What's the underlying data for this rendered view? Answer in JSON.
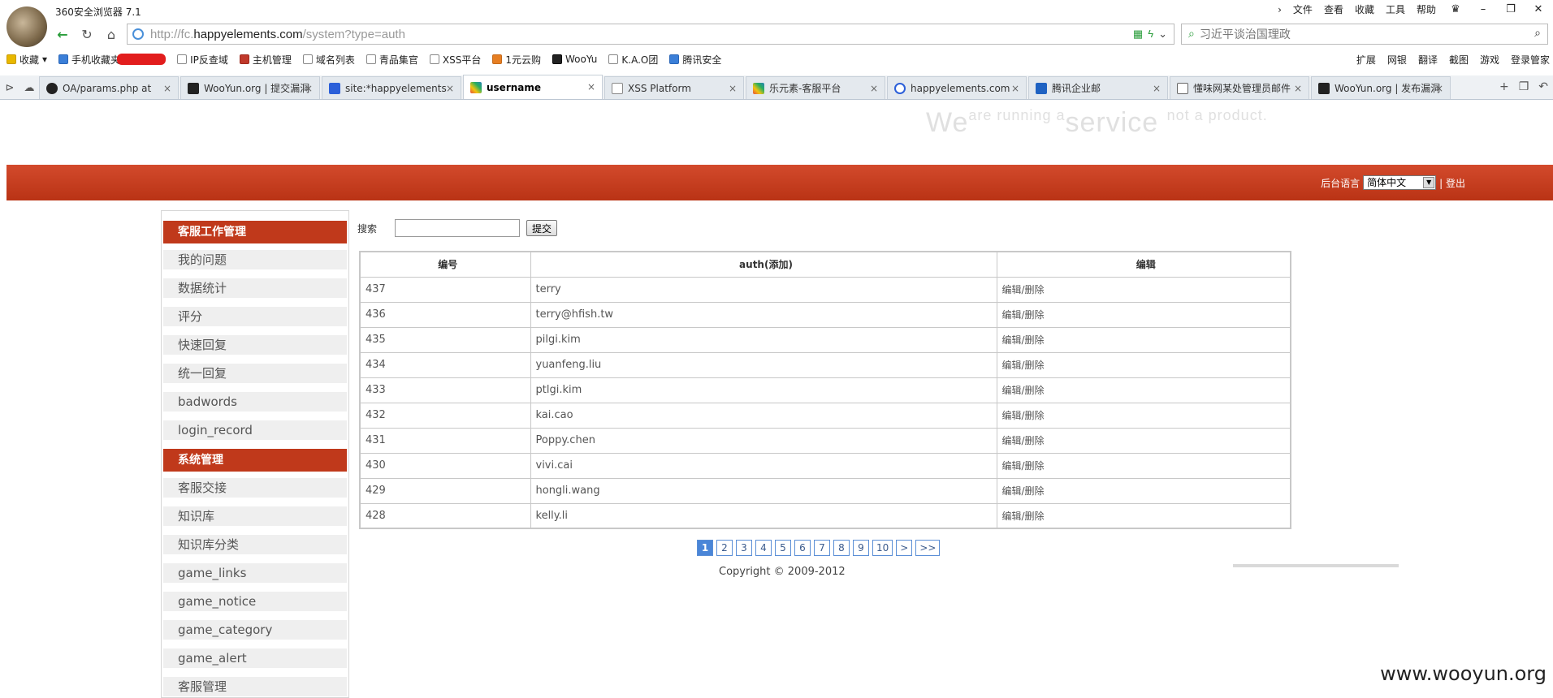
{
  "browser": {
    "title": "360安全浏览器 7.1",
    "menu": [
      "文件",
      "查看",
      "收藏",
      "工具",
      "帮助"
    ],
    "url_prefix": "http://fc.",
    "url_domain": "happyelements.com",
    "url_path": "/system?type=auth",
    "search_placeholder": "习近平谈治国理政",
    "bookmarks": [
      "收藏",
      "手机收藏夹",
      "IP反查域",
      "主机管理",
      "域名列表",
      "青品集官",
      "XSS平台",
      "1元云购",
      "WooYu",
      "K.A.O团",
      "腾讯安全"
    ],
    "bookmarks_right": [
      "扩展",
      "网银",
      "翻译",
      "截图",
      "游戏",
      "登录管家"
    ],
    "tabs": [
      {
        "label": "OA/params.php at",
        "active": false
      },
      {
        "label": "WooYun.org | 提交漏洞",
        "active": false
      },
      {
        "label": "site:*happyelements",
        "active": false
      },
      {
        "label": "username",
        "active": true
      },
      {
        "label": "XSS Platform",
        "active": false
      },
      {
        "label": "乐元素-客服平台",
        "active": false
      },
      {
        "label": "happyelements.com",
        "active": false
      },
      {
        "label": "腾讯企业邮",
        "active": false
      },
      {
        "label": "懂味网某处管理员邮件",
        "active": false
      },
      {
        "label": "WooYun.org | 发布漏洞",
        "active": false
      }
    ]
  },
  "header": {
    "slogan_a": "We",
    "slogan_b": "are running a",
    "slogan_c": "service",
    "slogan_d": "not a product.",
    "lang_label": "后台语言",
    "lang_value": "简体中文",
    "logout": "| 登出"
  },
  "sidebar": {
    "section1": "客服工作管理",
    "items1": [
      "我的问题",
      "数据统计",
      "评分",
      "快速回复",
      "统一回复",
      "badwords",
      "login_record"
    ],
    "section2": "系统管理",
    "items2": [
      "客服交接",
      "知识库",
      "知识库分类",
      "game_links",
      "game_notice",
      "game_category",
      "game_alert",
      "客服管理"
    ]
  },
  "search": {
    "label": "搜索",
    "button": "提交"
  },
  "table": {
    "headers": [
      "编号",
      "auth(添加)",
      "编辑"
    ],
    "edit_label": "编辑/删除",
    "rows": [
      {
        "id": "437",
        "auth": "terry"
      },
      {
        "id": "436",
        "auth": "terry@hfish.tw"
      },
      {
        "id": "435",
        "auth": "pilgi.kim"
      },
      {
        "id": "434",
        "auth": "yuanfeng.liu"
      },
      {
        "id": "433",
        "auth": "ptlgi.kim"
      },
      {
        "id": "432",
        "auth": "kai.cao"
      },
      {
        "id": "431",
        "auth": "Poppy.chen"
      },
      {
        "id": "430",
        "auth": "vivi.cai"
      },
      {
        "id": "429",
        "auth": "hongli.wang"
      },
      {
        "id": "428",
        "auth": "kelly.li"
      }
    ]
  },
  "pager": [
    "1",
    "2",
    "3",
    "4",
    "5",
    "6",
    "7",
    "8",
    "9",
    "10",
    ">",
    ">>"
  ],
  "copyright": "Copyright © 2009-2012",
  "watermark": "www.wooyun.org"
}
